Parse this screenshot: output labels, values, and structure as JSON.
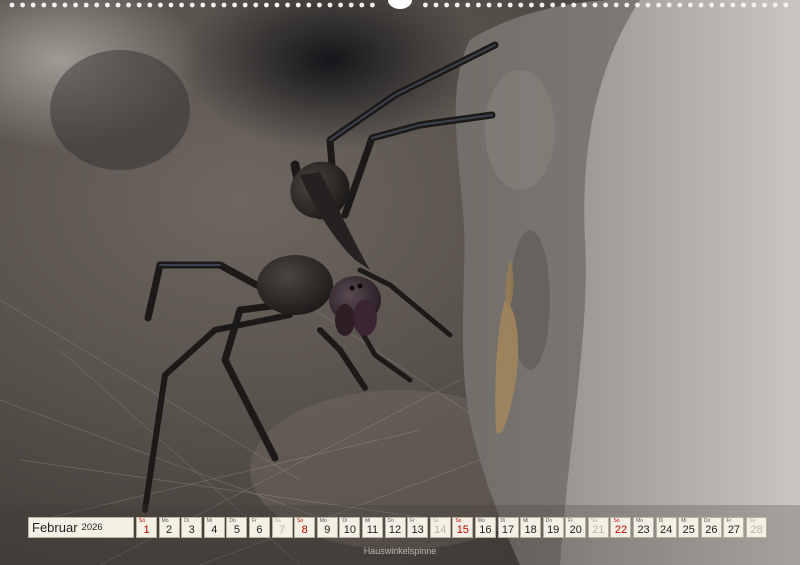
{
  "calendar": {
    "month": "Februar",
    "year": "2026",
    "days": [
      {
        "wd": "So",
        "num": "1",
        "kind": "sun"
      },
      {
        "wd": "Mo",
        "num": "2",
        "kind": "weekday"
      },
      {
        "wd": "Di",
        "num": "3",
        "kind": "weekday"
      },
      {
        "wd": "Mi",
        "num": "4",
        "kind": "weekday"
      },
      {
        "wd": "Do",
        "num": "5",
        "kind": "weekday"
      },
      {
        "wd": "Fr",
        "num": "6",
        "kind": "weekday"
      },
      {
        "wd": "Sa",
        "num": "7",
        "kind": "sat"
      },
      {
        "wd": "So",
        "num": "8",
        "kind": "sun"
      },
      {
        "wd": "Mo",
        "num": "9",
        "kind": "weekday"
      },
      {
        "wd": "Di",
        "num": "10",
        "kind": "weekday"
      },
      {
        "wd": "Mi",
        "num": "11",
        "kind": "weekday"
      },
      {
        "wd": "Do",
        "num": "12",
        "kind": "weekday"
      },
      {
        "wd": "Fr",
        "num": "13",
        "kind": "weekday"
      },
      {
        "wd": "Sa",
        "num": "14",
        "kind": "sat"
      },
      {
        "wd": "So",
        "num": "15",
        "kind": "sun"
      },
      {
        "wd": "Mo",
        "num": "16",
        "kind": "weekday"
      },
      {
        "wd": "Di",
        "num": "17",
        "kind": "weekday"
      },
      {
        "wd": "Mi",
        "num": "18",
        "kind": "weekday"
      },
      {
        "wd": "Do",
        "num": "19",
        "kind": "weekday"
      },
      {
        "wd": "Fr",
        "num": "20",
        "kind": "weekday"
      },
      {
        "wd": "Sa",
        "num": "21",
        "kind": "sat"
      },
      {
        "wd": "So",
        "num": "22",
        "kind": "sun"
      },
      {
        "wd": "Mo",
        "num": "23",
        "kind": "weekday"
      },
      {
        "wd": "Di",
        "num": "24",
        "kind": "weekday"
      },
      {
        "wd": "Mi",
        "num": "25",
        "kind": "weekday"
      },
      {
        "wd": "Do",
        "num": "26",
        "kind": "weekday"
      },
      {
        "wd": "Fr",
        "num": "27",
        "kind": "weekday"
      },
      {
        "wd": "Sa",
        "num": "28",
        "kind": "sat"
      }
    ]
  },
  "caption": "Hauswinkelspinne",
  "colors": {
    "sunday": "#c00000",
    "saturday": "#b9b3a6",
    "cell_background": "#f4f0e4"
  },
  "photo": {
    "subject": "spider-on-stone-wall"
  }
}
